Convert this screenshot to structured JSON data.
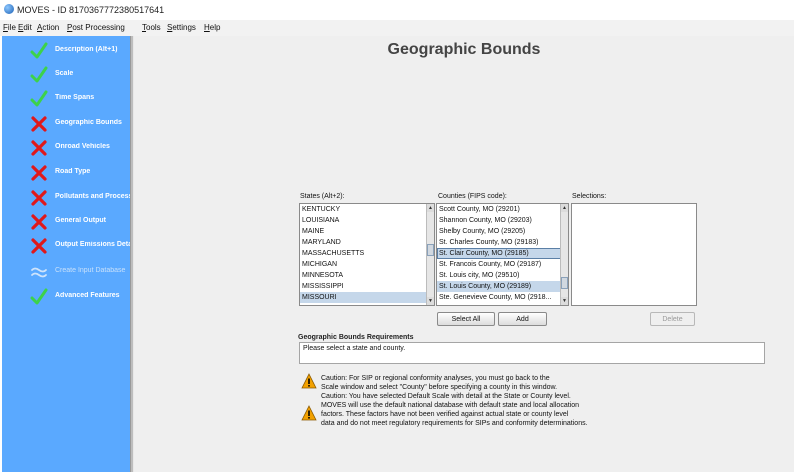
{
  "window": {
    "title": "MOVES - ID 8170367772380517641"
  },
  "menu": [
    {
      "label": "File"
    },
    {
      "label": "Edit"
    },
    {
      "label": "Action"
    },
    {
      "label": "Post Processing"
    },
    {
      "label": "Tools"
    },
    {
      "label": "Settings"
    },
    {
      "label": "Help"
    }
  ],
  "sidebar": {
    "items": [
      {
        "label": "Description (Alt+1)",
        "status": "check"
      },
      {
        "label": "Scale",
        "status": "check"
      },
      {
        "label": "Time Spans",
        "status": "check"
      },
      {
        "label": "Geographic Bounds",
        "status": "cross"
      },
      {
        "label": "Onroad Vehicles",
        "status": "cross"
      },
      {
        "label": "Road Type",
        "status": "cross"
      },
      {
        "label": "Pollutants and Processes",
        "status": "cross"
      },
      {
        "label": "General Output",
        "status": "cross"
      },
      {
        "label": "Output Emissions Detail",
        "status": "cross"
      },
      {
        "label": "Create Input Database",
        "status": "wave"
      },
      {
        "label": "Advanced Features",
        "status": "check"
      }
    ]
  },
  "main": {
    "title": "Geographic Bounds",
    "states_label": "States (Alt+2):",
    "counties_label": "Counties (FIPS code):",
    "selections_label": "Selections:",
    "states": [
      "KENTUCKY",
      "LOUISIANA",
      "MAINE",
      "MARYLAND",
      "MASSACHUSETTS",
      "MICHIGAN",
      "MINNESOTA",
      "MISSISSIPPI",
      "MISSOURI"
    ],
    "counties": [
      "Scott County, MO (29201)",
      "Shannon County, MO (29203)",
      "Shelby County, MO (29205)",
      "St. Charles County, MO (29183)",
      "St. Clair County, MO (29185)",
      "St. Francois County, MO (29187)",
      "St. Louis city, MO (29510)",
      "St. Louis County, MO (29189)",
      "Ste. Genevieve County, MO (2918..."
    ],
    "select_all_label": "Select All",
    "add_label": "Add",
    "delete_label": "Delete",
    "requirements_label": "Geographic Bounds Requirements",
    "requirements_text": "Please select a state and county.",
    "caution1_line1": "Caution: For SIP or regional conformity analyses, you must go back to the",
    "caution1_line2": "Scale window and select \"County\" before specifying a county in this window.",
    "caution2_line1": "Caution: You have selected Default Scale with detail at the State or County level.",
    "caution2_line2": "MOVES will use the default national database with default state and local allocation",
    "caution2_line3": "factors. These factors have not been verified against actual state or county level",
    "caution2_line4": "data and do not meet regulatory requirements for SIPs and conformity determinations."
  },
  "colors": {
    "sidebar": "#5aa9ff",
    "check": "#3dd24a",
    "cross": "#e0181b",
    "warning": "#f2a100"
  },
  "icons": {
    "check": "check-icon",
    "cross": "cross-icon",
    "wave": "approx-icon",
    "warning": "warning-icon"
  }
}
